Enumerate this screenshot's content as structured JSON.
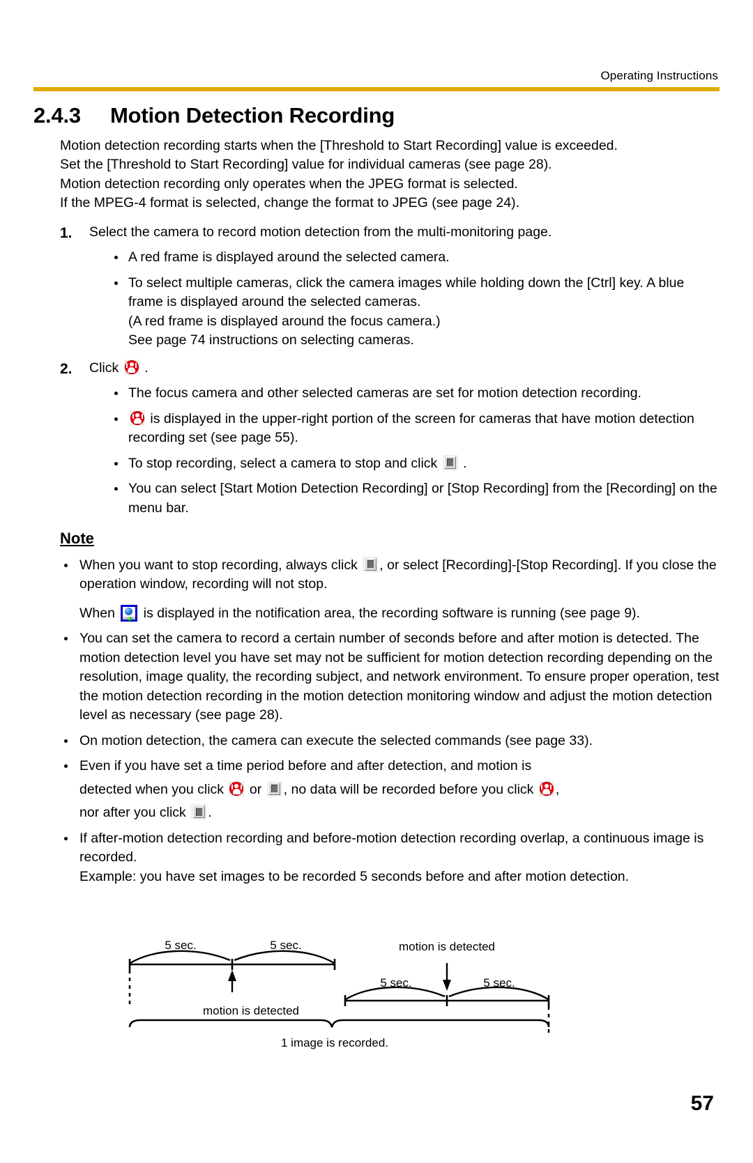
{
  "header": {
    "title": "Operating Instructions",
    "rule_color": "#e0ac00"
  },
  "section": {
    "number": "2.4.3",
    "title": "Motion Detection Recording"
  },
  "intro": [
    "Motion detection recording starts when the [Threshold to Start Recording] value is exceeded.",
    "Set the [Threshold to Start Recording] value for individual cameras (see page 28).",
    "Motion detection recording only operates when the JPEG format is selected.",
    "If the MPEG-4 format is selected, change the format to JPEG (see page 24)."
  ],
  "steps": [
    {
      "number": "1.",
      "text": "Select the camera to record motion detection from the multi-monitoring page.",
      "bullets": [
        "A red frame is displayed around the selected camera.",
        "To select multiple cameras, click the camera images while holding down the [Ctrl] key. A blue frame is displayed around the selected cameras.\n(A red frame is displayed around the focus camera.)\nSee page 74 instructions on selecting cameras."
      ]
    },
    {
      "number": "2.",
      "click_label": "Click",
      "click_trailing": ".",
      "bullets": [
        "The focus camera and other selected cameras are set for motion detection recording.",
        "is displayed in the upper-right portion of the screen for cameras that have motion detection recording set (see page 55).",
        "To stop recording, select a camera to stop and click",
        "You can select [Start Motion Detection Recording] or [Stop Recording] from the [Recording] on the menu bar."
      ]
    }
  ],
  "step2": {
    "bullet2_suffix": "is displayed in the upper-right portion of the screen for cameras that have motion detection recording set (see page 55).",
    "bullet3_prefix": "To stop recording, select a camera to stop and click",
    "bullet3_suffix": ".",
    "bullet4": "You can select [Start Motion Detection Recording] or [Stop Recording] from the [Recording] on the menu bar."
  },
  "note": {
    "heading": "Note",
    "items": {
      "n1_prefix": "When you want to stop recording, always click",
      "n1_suffix": ", or select [Recording]-[Stop Recording]. If you close the operation window, recording will not stop.",
      "n1b_prefix": "When",
      "n1b_suffix": "is displayed in the notification area, the recording software is running (see page 9).",
      "n2": "You can set the camera to record a certain number of seconds before and after motion is detected. The motion detection level you have set may not be sufficient for motion detection recording depending on the resolution, image quality, the recording subject, and network environment. To ensure proper operation, test the motion detection recording in the motion detection monitoring window and adjust the motion detection level as necessary (see page 28).",
      "n3": "On motion detection, the camera can execute the selected commands (see page 33).",
      "n4_a": "Even if you have set a time period before and after detection, and motion is",
      "n4_b": "detected when you click",
      "n4_c": "or",
      "n4_d": ", no data will be recorded before you click",
      "n4_e": ",",
      "n4_f": "nor after you click",
      "n4_g": ".",
      "n5": "If after-motion detection recording and before-motion detection recording overlap, a continuous image is recorded.\nExample: you have set images to be recorded 5 seconds before and after motion detection."
    }
  },
  "diagram": {
    "label_5sec_1": "5 sec.",
    "label_5sec_2": "5 sec.",
    "label_5sec_3": "5 sec.",
    "label_5sec_4": "5 sec.",
    "label_motion_left": "motion is detected",
    "label_motion_right": "motion is detected",
    "label_result": "1 image is recorded."
  },
  "page_number": "57",
  "icons": {
    "motion": "motion-detection-record-icon",
    "stop": "stop-recording-icon",
    "tray": "notification-area-icon"
  }
}
